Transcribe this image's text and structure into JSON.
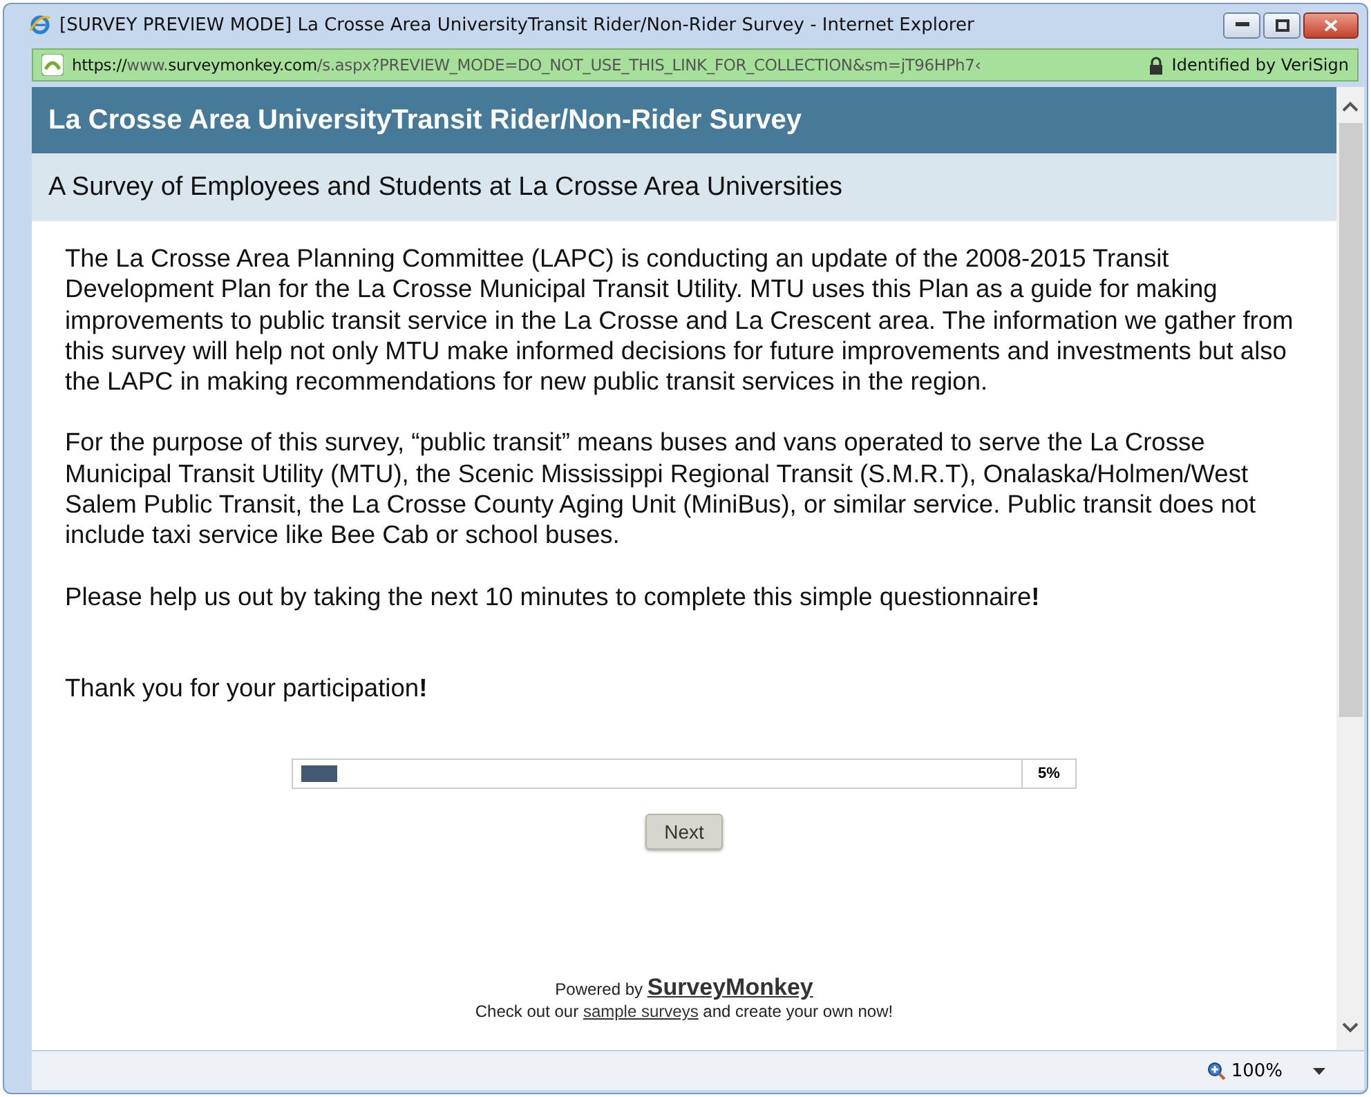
{
  "window": {
    "title": "[SURVEY PREVIEW MODE] La Crosse Area UniversityTransit Rider/Non-Rider Survey - Internet Explorer"
  },
  "address_bar": {
    "url": [
      {
        "text": "https://",
        "emphasis": true
      },
      {
        "text": "www.",
        "emphasis": false
      },
      {
        "text": "surveymonkey.com",
        "emphasis": true
      },
      {
        "text": "/s.aspx?PREVIEW_MODE=DO_NOT_USE_THIS_LINK_FOR_COLLECTION&sm=jT96HPh7‹",
        "emphasis": false
      }
    ],
    "identity": "Identified by VeriSign"
  },
  "survey": {
    "title": "La Crosse Area UniversityTransit Rider/Non-Rider Survey",
    "subtitle": "A Survey of Employees and Students at La Crosse Area Universities",
    "paragraphs": [
      "The La Crosse Area Planning Committee (LAPC) is conducting an update of the 2008-2015 Transit Development Plan for the La Crosse Municipal Transit Utility. MTU uses this Plan as a guide for making improvements to public transit service in the La Crosse and La Crescent area. The information we gather from this survey will help not only MTU make informed decisions for future improvements and investments but also the LAPC in making recommendations for new public transit services in the region.",
      "For the purpose of this survey, “public transit” means buses and vans operated to serve the La Crosse Municipal Transit Utility (MTU), the Scenic Mississippi Regional Transit (S.M.R.T), Onalaska/Holmen/West Salem Public Transit, the La Crosse County Aging Unit (MiniBus), or similar service. Public transit does not include taxi service like Bee Cab or school buses.",
      "Please help us out by taking the next 10 minutes to complete this simple questionnaire**!**",
      "Thank you for your participation**!**"
    ],
    "progress": {
      "level": 0.05,
      "reading": "5%"
    },
    "next_button": "Next",
    "footer": {
      "powered_by": "Powered by",
      "brand": "SurveyMonkey",
      "line_start": "Check out our",
      "link": "sample surveys",
      "line_end": "and create your own now!"
    }
  },
  "status_bar": {
    "zoom": "100%"
  }
}
